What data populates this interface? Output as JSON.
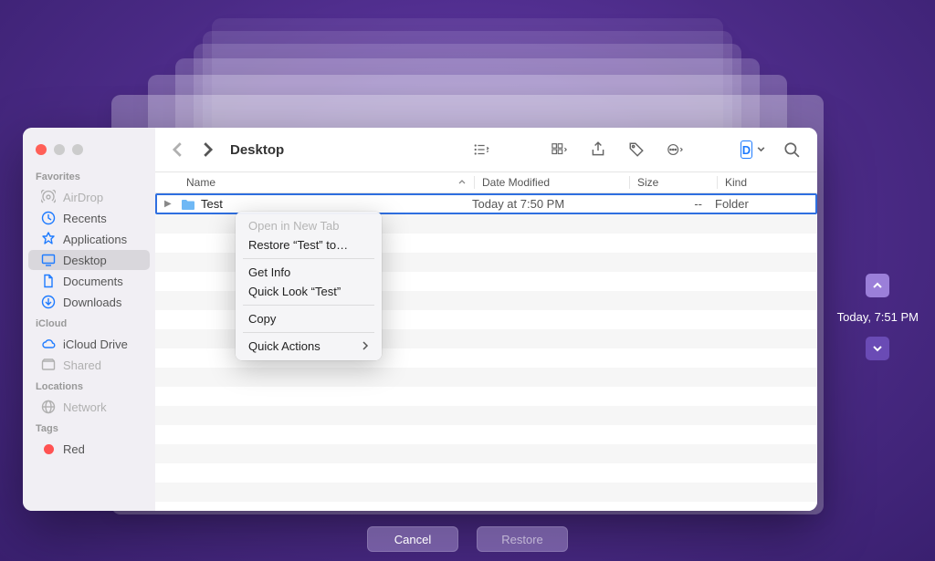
{
  "sidebar": {
    "sections": [
      {
        "label": "Favorites",
        "items": [
          {
            "name": "AirDrop",
            "icon": "airdrop",
            "dimmed": true
          },
          {
            "name": "Recents",
            "icon": "clock"
          },
          {
            "name": "Applications",
            "icon": "apps"
          },
          {
            "name": "Desktop",
            "icon": "desktop",
            "selected": true
          },
          {
            "name": "Documents",
            "icon": "doc"
          },
          {
            "name": "Downloads",
            "icon": "download"
          }
        ]
      },
      {
        "label": "iCloud",
        "items": [
          {
            "name": "iCloud Drive",
            "icon": "cloud"
          },
          {
            "name": "Shared",
            "icon": "shared",
            "dimmed": true
          }
        ]
      },
      {
        "label": "Locations",
        "items": [
          {
            "name": "Network",
            "icon": "network",
            "dimmed": true
          }
        ]
      },
      {
        "label": "Tags",
        "items": [
          {
            "name": "Red",
            "icon": "tag-red"
          }
        ]
      }
    ]
  },
  "toolbar": {
    "title": "Desktop"
  },
  "columns": {
    "name": "Name",
    "date": "Date Modified",
    "size": "Size",
    "kind": "Kind"
  },
  "rows": [
    {
      "name": "Test",
      "date": "Today at 7:50 PM",
      "size": "--",
      "kind": "Folder",
      "selected": true
    }
  ],
  "context_menu": {
    "items": [
      {
        "label": "Open in New Tab",
        "disabled": true
      },
      {
        "label": "Restore “Test” to…"
      },
      {
        "sep": true
      },
      {
        "label": "Get Info"
      },
      {
        "label": "Quick Look “Test”"
      },
      {
        "sep": true
      },
      {
        "label": "Copy"
      },
      {
        "sep": true
      },
      {
        "label": "Quick Actions",
        "submenu": true
      }
    ]
  },
  "timeline": {
    "label": "Today, 7:51 PM"
  },
  "buttons": {
    "cancel": "Cancel",
    "restore": "Restore"
  }
}
